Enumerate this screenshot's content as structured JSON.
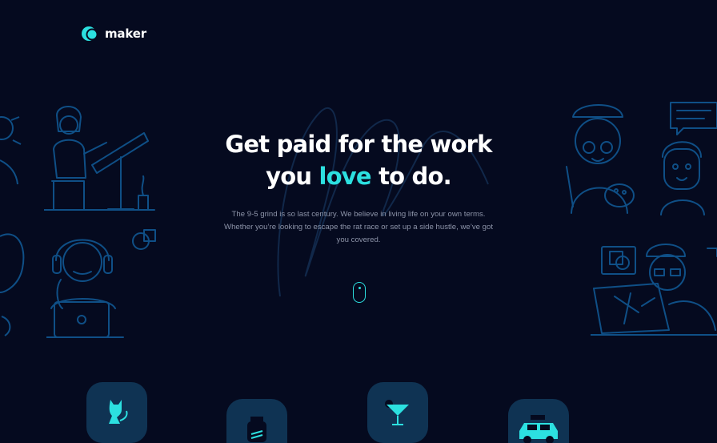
{
  "brand": {
    "name": "maker"
  },
  "hero": {
    "headline_part1": "Get paid for the work",
    "headline_part2": "you",
    "headline_accent": "love",
    "headline_part3": "to do.",
    "subtext": "The 9-5 grind is so last century. We believe in living life on your own terms. Whether you’re looking to escape the rat race or set up a side hustle, we’ve got you covered."
  },
  "colors": {
    "background": "#050a1f",
    "accent": "#2ce0e0",
    "line_art": "#0f4f86",
    "tile": "#0f3353",
    "muted_text": "#8c93a8"
  },
  "icons": {
    "scroll": "scroll-mouse-icon",
    "tiles": [
      "cat-icon",
      "jar-icon",
      "cocktail-icon",
      "car-icon"
    ]
  }
}
